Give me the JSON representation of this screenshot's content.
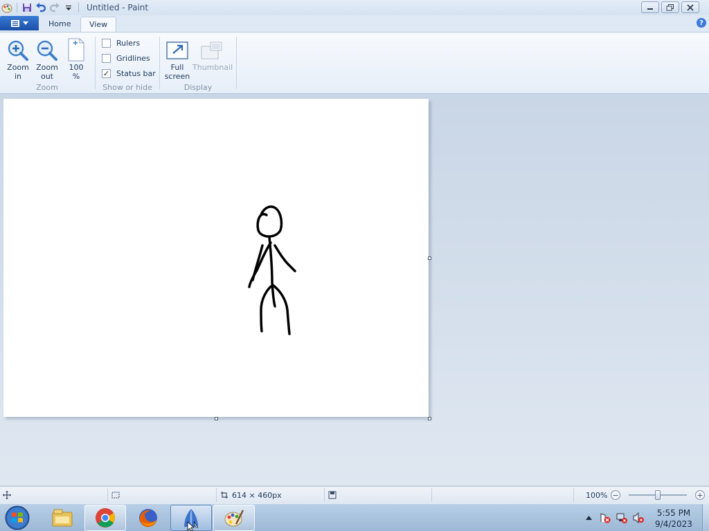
{
  "window": {
    "title": "Untitled - Paint",
    "minimize_icon": "minimize-icon",
    "maximize_icon": "restore-icon",
    "close_icon": "close-icon"
  },
  "qat": [
    "paint-app-icon",
    "save-icon",
    "undo-icon",
    "redo-icon",
    "customize-dropdown-icon"
  ],
  "tabs": [
    {
      "label": "Home",
      "active": false
    },
    {
      "label": "View",
      "active": true
    }
  ],
  "ribbon": {
    "zoom_group": {
      "label": "Zoom",
      "zoom_in": "Zoom\nin",
      "zoom_in_l1": "Zoom",
      "zoom_in_l2": "in",
      "zoom_out_l1": "Zoom",
      "zoom_out_l2": "out",
      "zoom100_l1": "100",
      "zoom100_l2": "%"
    },
    "show_group": {
      "label": "Show or hide",
      "rulers": {
        "label": "Rulers",
        "checked": false
      },
      "gridlines": {
        "label": "Gridlines",
        "checked": false
      },
      "statusbar": {
        "label": "Status bar",
        "checked": true
      }
    },
    "display_group": {
      "label": "Display",
      "full_l1": "Full",
      "full_l2": "screen",
      "thumbnail": "Thumbnail"
    }
  },
  "statusbar": {
    "image_size": "614 × 460px",
    "zoom_level": "100%"
  },
  "taskbar": {
    "apps": [
      "windows-explorer-icon",
      "chrome-icon",
      "firefox-icon",
      "app-icon",
      "paint-icon"
    ],
    "clock_time": "5:55 PM",
    "clock_date": "9/4/2023"
  },
  "colors": {
    "accent": "#1a4ea8",
    "ribbon_bg": "#f1f5fb",
    "workspace_bg": "#cdd8e6"
  }
}
